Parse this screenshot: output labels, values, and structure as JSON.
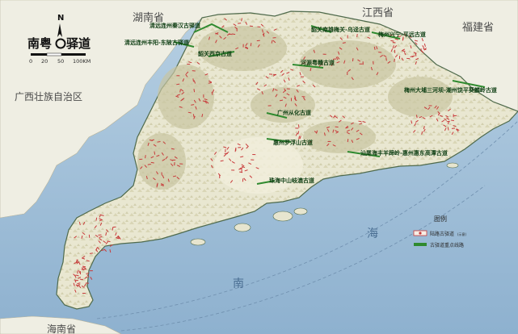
{
  "title": {
    "prefix": "南粤",
    "suffix": "驿道",
    "compass": "N"
  },
  "scale": {
    "ticks": [
      "0",
      "20",
      "50",
      "100KM"
    ]
  },
  "regions": {
    "hunan": "湖南省",
    "jiangxi": "江西省",
    "fujian": "福建省",
    "guangxi": "广西壮族自治区",
    "hainan": "海南省"
  },
  "seas": {
    "nan": "南",
    "hai": "海"
  },
  "legend": {
    "title": "图例",
    "items": [
      {
        "label": "陆路古驿道",
        "note": "(示意)",
        "color": "#c83a3a"
      },
      {
        "label": "古驿道重点线路",
        "note": "",
        "color": "#2f8a2f"
      }
    ]
  },
  "routes": [
    "清远连州秦汉古驿道",
    "清远连州丰阳-东陂古驿道",
    "韶关南雄梅关-乌迳古道",
    "梅州兴宁-平远古道",
    "韶关西京古道",
    "河源粤赣古道",
    "梅州大埔三河坝-潮州饶平葵麟岭古道",
    "广州从化古道",
    "惠州罗浮山古道",
    "汕尾海丰羊蹄岭-惠州惠东高潭古道",
    "珠海中山岐澳古道"
  ],
  "colors": {
    "sea": "#9fbfd9",
    "land": "#e7e6cf",
    "mountain": "#c8c7a2",
    "coast": "#5a6f57",
    "route_red": "#c83a3a",
    "route_green": "#2f8a2f"
  }
}
